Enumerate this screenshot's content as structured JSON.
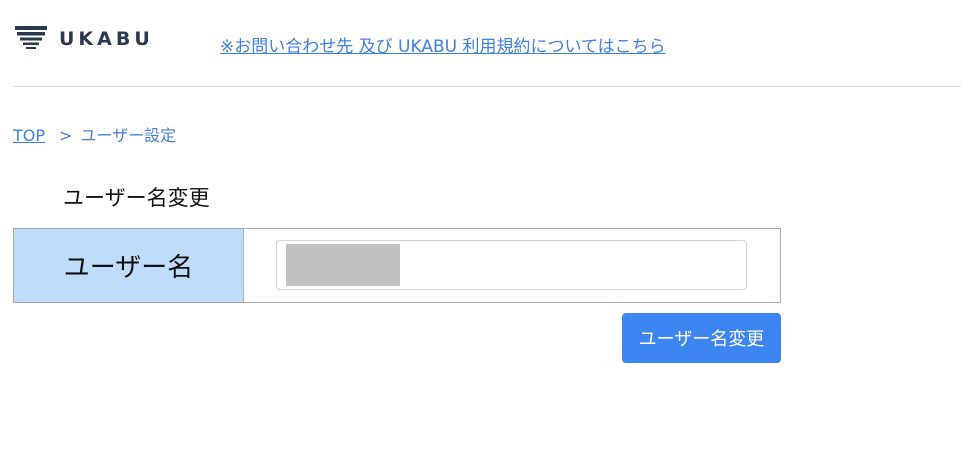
{
  "header": {
    "logo_text": "UKABU",
    "contact_terms_link": "※お問い合わせ先 及び UKABU 利用規約についてはこちら"
  },
  "breadcrumb": {
    "top_link": "TOP",
    "separator": ">",
    "current": "ユーザー設定"
  },
  "main": {
    "section_title": "ユーザー名変更",
    "form": {
      "username_label": "ユーザー名",
      "username_value": ""
    },
    "submit_label": "ユーザー名変更"
  },
  "colors": {
    "brand": "#2c3850",
    "link": "#3f7fe0",
    "label_background": "#bfdcfb",
    "button": "#3d85f0"
  },
  "icons": {
    "logo": "ukabu-wave-logo-icon"
  }
}
